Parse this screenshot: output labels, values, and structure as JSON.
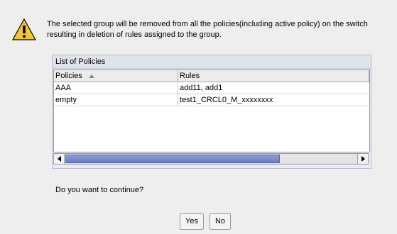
{
  "dialog": {
    "message_line1": "The selected group will be removed from all the policies(including active policy) on the switch",
    "message_line2": "resulting in deletion of rules assigned to the group.",
    "question": "Do you want to continue?",
    "icon": "warning-icon"
  },
  "panel": {
    "title": "List of Policies",
    "columns": [
      "Policies",
      "Rules"
    ],
    "sort_indicator": "ascending",
    "rows": [
      {
        "policy": "AAA",
        "rules": "add11, add1"
      },
      {
        "policy": "empty",
        "rules": "test1_CRCL0_M_xxxxxxxx"
      }
    ]
  },
  "buttons": {
    "yes": "Yes",
    "no": "No"
  }
}
